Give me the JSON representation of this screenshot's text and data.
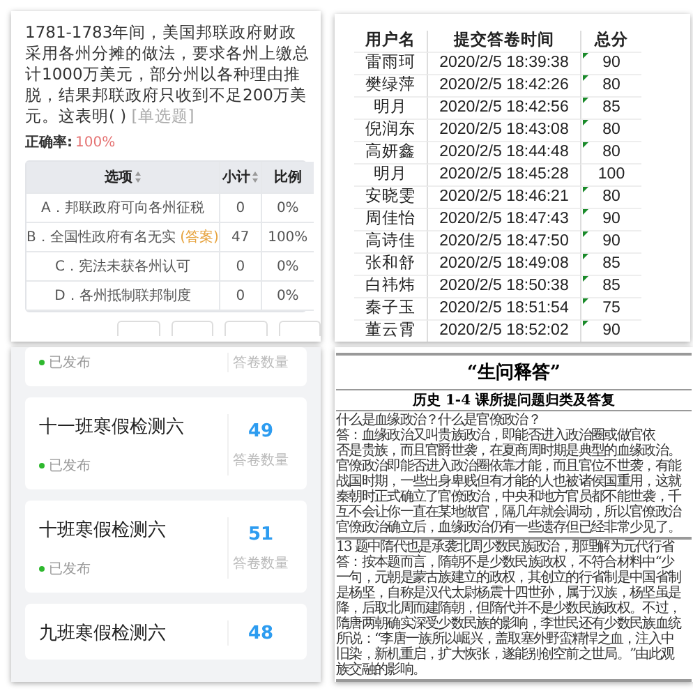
{
  "quiz": {
    "question": "1781-1783年间，美国邦联政府财政采用各州分摊的做法，要求各州上缴总计1000万美元，部分州以各种理由推脱，结果邦联政府只收到不足200万美元。这表明(      )",
    "question_type": "[单选题]",
    "accuracy_label": "正确率:",
    "accuracy": "100%",
    "columns": [
      {
        "label": "选项",
        "sortable": true
      },
      {
        "label": "小计",
        "sortable": true
      },
      {
        "label": "比例",
        "sortable": false
      }
    ],
    "options": [
      {
        "text": "A．邦联政府可向各州征税",
        "count": "0",
        "ratio": "0%"
      },
      {
        "text": "B．全国性政府有名无实",
        "answer_tag": "(答案)",
        "count": "47",
        "ratio": "100%"
      },
      {
        "text": "C．宪法未获各州认可",
        "count": "0",
        "ratio": "0%"
      },
      {
        "text": "D．各州抵制联邦制度",
        "count": "0",
        "ratio": "0%"
      }
    ]
  },
  "scores": {
    "columns": [
      "用户名",
      "提交答卷时间",
      "总分"
    ],
    "rows": [
      {
        "name": "雷雨珂",
        "time": "2020/2/5 18:39:38",
        "score": "90",
        "flagged": true
      },
      {
        "name": "樊绿萍",
        "time": "2020/2/5 18:42:26",
        "score": "80",
        "flagged": true
      },
      {
        "name": "明月",
        "time": "2020/2/5 18:42:56",
        "score": "85",
        "flagged": true
      },
      {
        "name": "倪润东",
        "time": "2020/2/5 18:43:08",
        "score": "80",
        "flagged": true
      },
      {
        "name": "高妍鑫",
        "time": "2020/2/5 18:44:48",
        "score": "80",
        "flagged": true
      },
      {
        "name": "明月",
        "time": "2020/2/5 18:45:28",
        "score": "100",
        "flagged": false
      },
      {
        "name": "安晓雯",
        "time": "2020/2/5 18:46:21",
        "score": "80",
        "flagged": true
      },
      {
        "name": "周佳怡",
        "time": "2020/2/5 18:47:43",
        "score": "90",
        "flagged": true
      },
      {
        "name": "高诗佳",
        "time": "2020/2/5 18:47:50",
        "score": "90",
        "flagged": true
      },
      {
        "name": "张和舒",
        "time": "2020/2/5 18:49:08",
        "score": "85",
        "flagged": true
      },
      {
        "name": "白祎炜",
        "time": "2020/2/5 18:50:38",
        "score": "85",
        "flagged": true
      },
      {
        "name": "秦子玉",
        "time": "2020/2/5 18:51:54",
        "score": "75",
        "flagged": true
      },
      {
        "name": "董云霄",
        "time": "2020/2/5 18:52:02",
        "score": "90",
        "flagged": true
      }
    ]
  },
  "survey_list": [
    {
      "status": "已发布",
      "count_label": "答卷数量"
    },
    {
      "title": "十一班寒假检测六",
      "status": "已发布",
      "count": "49",
      "count_label": "答卷数量"
    },
    {
      "title": "十班寒假检测六",
      "status": "已发布",
      "count": "51",
      "count_label": "答卷数量"
    },
    {
      "title": "九班寒假检测六",
      "count": "48"
    }
  ],
  "document": {
    "title": "“生问释答”",
    "subtitle": "历史 1-4 课所提问题归类及答复",
    "sections": [
      {
        "lines": [
          "什么是血缘政治？什么是官僚政治？",
          "答：血缘政治又叫贵族政治，即能否进入政治圈或做官依",
          "否是贵族，而且官爵世袭，在夏商周时期是典型的血缘政治。",
          "官僚政治即能否进入政治圈依靠才能，而且官位不世袭，有能",
          "战国时期，一些出身卑贱但有才能的人也被诸侯国重用，这就",
          "秦朝时正式确立了官僚政治，中央和地方官员都不能世袭，千",
          "互不会让你一直在某地做官，隔几年就会调动，所以官僚政治",
          "官僚政治确立后，血缘政治仍有一些遗存但已经非常少见了。"
        ]
      },
      {
        "lines": [
          "13 题中隋代也是承袭北周少数民族政治，那理解为元代行省",
          "答：按本题而言，隋朝不是少数民族政权，不符合材料中“少",
          "一句，元朝是蒙古族建立的政权，其创立的行省制是中国省制",
          "是杨坚，自称是汉代太尉杨震十四世孙，属于汉族，杨坚虽是",
          "降，后取北周而建隋朝，但隋代并不是少数民族政权。不过，",
          "隋唐两朝确实深受少数民族的影响，李世民还有少数民族血统",
          "所说：“李唐一族所以崛兴，盖取塞外野蛮精悍之血，注入中",
          "旧染，新机重启，扩大恢张，遂能别创空前之世局。”由此观",
          "族交融的影响。"
        ]
      }
    ]
  }
}
